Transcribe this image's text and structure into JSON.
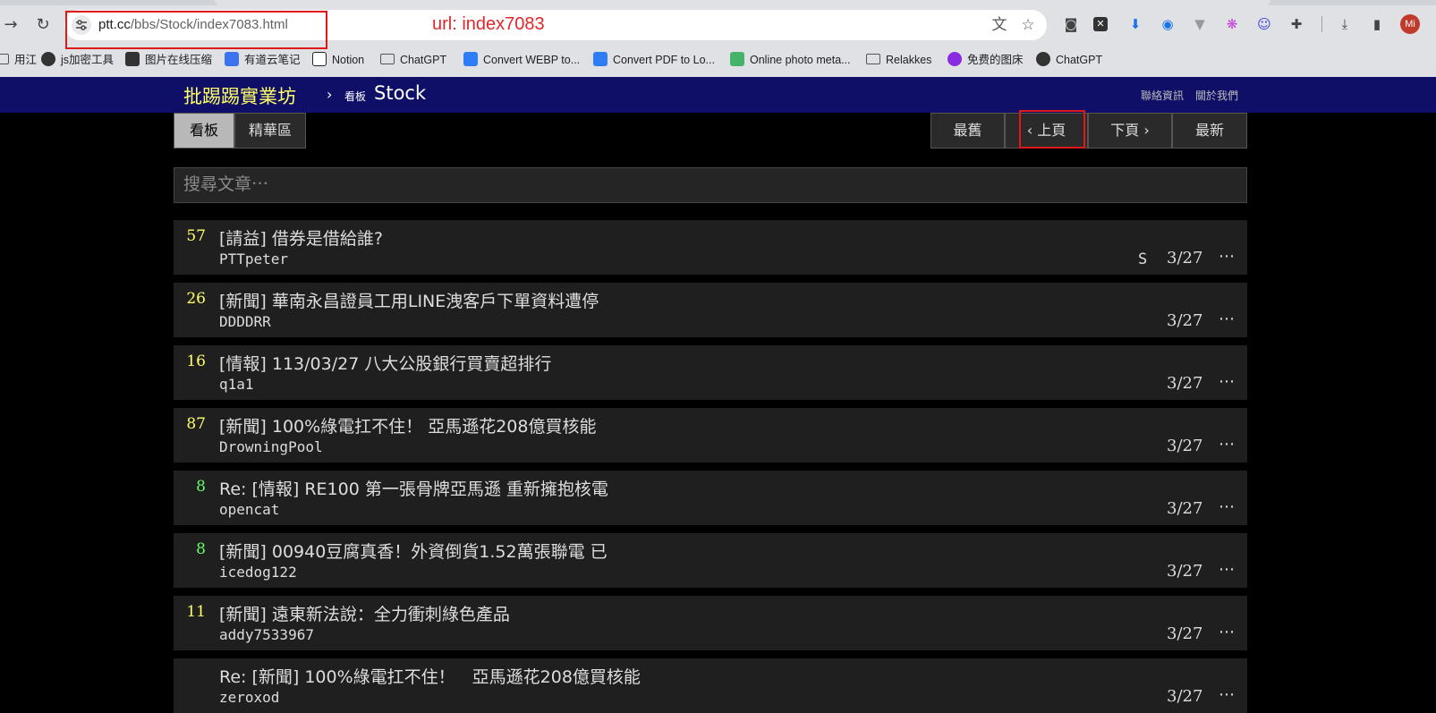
{
  "browser": {
    "url_host": "ptt.cc",
    "url_path": "/bbs/Stock/index7083.html",
    "annotation": "url: index7083",
    "avatar_initials": "Mi",
    "bookmarks": [
      {
        "label": "用江",
        "icon": "folder-icon"
      },
      {
        "label": "js加密工具",
        "icon": "globe-icon"
      },
      {
        "label": "图片在线压缩",
        "icon": "panda-icon"
      },
      {
        "label": "有道云笔记",
        "icon": "note-icon"
      },
      {
        "label": "Notion",
        "icon": "notion-icon"
      },
      {
        "label": "ChatGPT",
        "icon": "folder-icon"
      },
      {
        "label": "Convert WEBP to...",
        "icon": "heart-icon"
      },
      {
        "label": "Convert PDF to Lo...",
        "icon": "doc-icon"
      },
      {
        "label": "Online photo meta...",
        "icon": "photo-icon"
      },
      {
        "label": "Relakkes",
        "icon": "folder-icon"
      },
      {
        "label": "免费的图床",
        "icon": "s-icon"
      },
      {
        "label": "ChatGPT",
        "icon": "globe-icon"
      }
    ]
  },
  "site": {
    "title": "批踢踢實業坊",
    "crumb_sep": "›",
    "crumb_kind": "看板",
    "board": "Stock",
    "links": [
      "聯絡資訊",
      "關於我們"
    ]
  },
  "tabs": [
    "看板",
    "精華區"
  ],
  "pager": {
    "oldest": "最舊",
    "prev": "‹ 上頁",
    "next": "下頁 ›",
    "newest": "最新"
  },
  "search": {
    "placeholder": "搜尋文章⋯"
  },
  "posts": [
    {
      "push": "57",
      "title": "[請益] 借券是借給誰?",
      "author": "PTTpeter",
      "mark": "S",
      "date": "3/27",
      "more": "⋯"
    },
    {
      "push": "26",
      "title": "[新聞] 華南永昌證員工用LINE洩客戶下單資料遭停",
      "author": "DDDDRR",
      "mark": "",
      "date": "3/27",
      "more": "⋯"
    },
    {
      "push": "16",
      "title": "[情報] 113/03/27 八大公股銀行買賣超排行",
      "author": "q1a1",
      "mark": "",
      "date": "3/27",
      "more": "⋯"
    },
    {
      "push": "87",
      "title": "[新聞] 100%綠電扛不住！ 亞馬遜花208億買核能",
      "author": "DrowningPool",
      "mark": "",
      "date": "3/27",
      "more": "⋯"
    },
    {
      "push": "8",
      "title": "Re: [情報] RE100 第一張骨牌亞馬遜 重新擁抱核電",
      "author": "opencat",
      "mark": "",
      "date": "3/27",
      "more": "⋯"
    },
    {
      "push": "8",
      "title": "[新聞] 00940豆腐真香！外資倒貨1.52萬張聯電 已",
      "author": "icedog122",
      "mark": "",
      "date": "3/27",
      "more": "⋯"
    },
    {
      "push": "11",
      "title": "[新聞] 遠東新法說：全力衝刺綠色產品",
      "author": "addy7533967",
      "mark": "",
      "date": "3/27",
      "more": "⋯"
    },
    {
      "push": "",
      "title": "Re: [新聞] 100%綠電扛不住！　亞馬遜花208億買核能",
      "author": "zeroxod",
      "mark": "",
      "date": "3/27",
      "more": "⋯"
    }
  ]
}
